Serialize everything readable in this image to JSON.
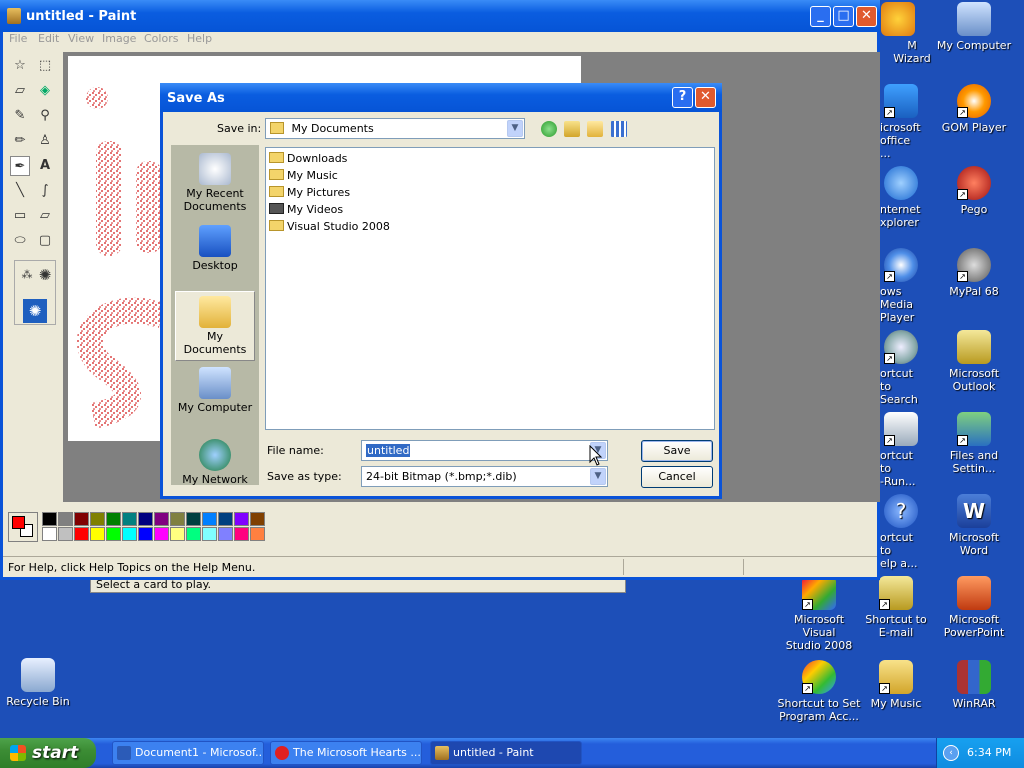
{
  "desktop": {
    "icons": [
      {
        "label": "M Wizard"
      },
      {
        "label": "My Computer"
      },
      {
        "label": "icrosoft\noffice ..."
      },
      {
        "label": "GOM Player"
      },
      {
        "label": "nternet\nxplorer"
      },
      {
        "label": "Pego"
      },
      {
        "label": "ows Media\nPlayer"
      },
      {
        "label": "MyPal 68"
      },
      {
        "label": "ortcut to\nSearch"
      },
      {
        "label": "Microsoft\nOutlook"
      },
      {
        "label": "ortcut to\n-Run..."
      },
      {
        "label": "Files and\nSettin..."
      },
      {
        "label": "ortcut to\nelp a..."
      },
      {
        "label": "Microsoft Word"
      },
      {
        "label": "Microsoft Visual\nStudio 2008"
      },
      {
        "label": "Shortcut to\nE-mail"
      },
      {
        "label": "Microsoft\nPowerPoint"
      },
      {
        "label": "Shortcut to Set\nProgram Acc..."
      },
      {
        "label": "My Music"
      },
      {
        "label": "WinRAR"
      },
      {
        "label": "Recycle Bin"
      }
    ]
  },
  "paint": {
    "title": "untitled - Paint",
    "menu": [
      "File",
      "Edit",
      "View",
      "Image",
      "Colors",
      "Help"
    ],
    "status": "For Help, click Help Topics on the Help Menu."
  },
  "behind_window": {
    "text": "Select a card to play."
  },
  "dialog": {
    "title": "Save As",
    "save_in_label": "Save in:",
    "save_in_value": "My Documents",
    "places": [
      "My Recent\nDocuments",
      "Desktop",
      "My Documents",
      "My Computer",
      "My Network"
    ],
    "files": [
      "Downloads",
      "My Music",
      "My Pictures",
      "My Videos",
      "Visual Studio 2008"
    ],
    "file_name_label": "File name:",
    "file_name_value": "untitled",
    "save_type_label": "Save as type:",
    "save_type_value": "24-bit Bitmap (*.bmp;*.dib)",
    "save_button": "Save",
    "cancel_button": "Cancel"
  },
  "taskbar": {
    "start_label": "start",
    "tasks": [
      "Document1 - Microsof...",
      "The Microsoft Hearts ...",
      "untitled - Paint"
    ],
    "clock": "6:34 PM"
  },
  "colors": {
    "palette": [
      "#000000",
      "#808080",
      "#800000",
      "#808000",
      "#008000",
      "#008080",
      "#000080",
      "#800080",
      "#808040",
      "#004040",
      "#0080ff",
      "#004080",
      "#8000ff",
      "#804000",
      "#ffffff",
      "#c0c0c0",
      "#ff0000",
      "#ffff00",
      "#00ff00",
      "#00ffff",
      "#0000ff",
      "#ff00ff",
      "#ffff80",
      "#00ff80",
      "#80ffff",
      "#8080ff",
      "#ff0080",
      "#ff8040"
    ],
    "foreground": "#ff0000",
    "background": "#ffffff"
  }
}
